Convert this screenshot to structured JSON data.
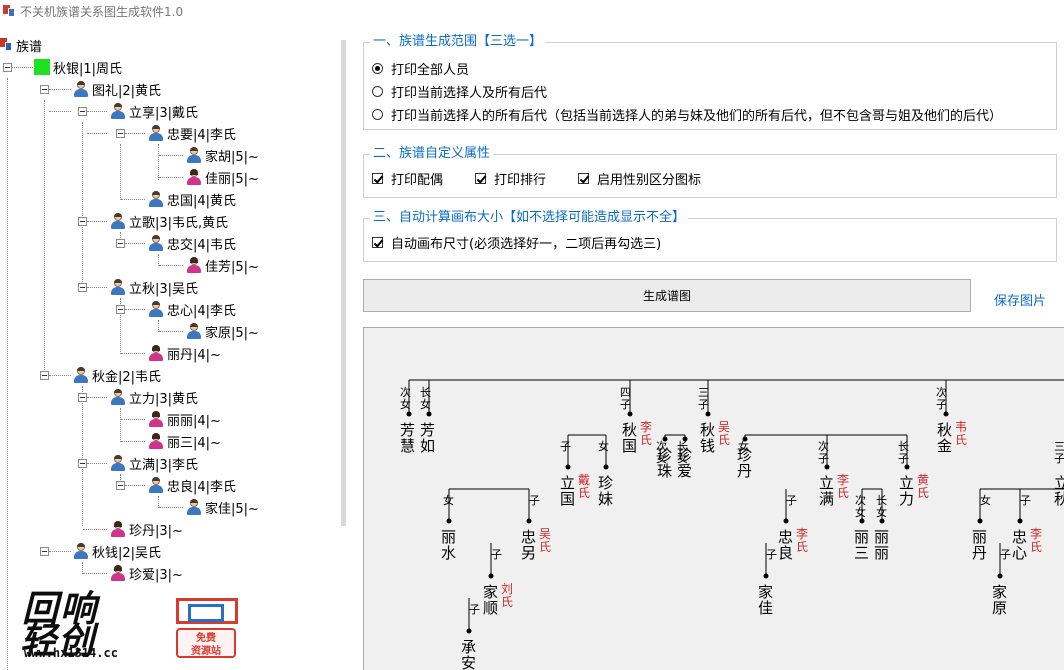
{
  "window": {
    "title": "不关机族谱关系图生成软件1.0"
  },
  "tree": {
    "root_label": "族谱",
    "nodes": [
      {
        "label": "秋银|1|周氏",
        "icon": "green-square-icon"
      },
      {
        "label": "图礼|2|黄氏",
        "icon": "male-person-icon"
      },
      {
        "label": "立享|3|戴氏",
        "icon": "male-person-icon"
      },
      {
        "label": "忠要|4|李氏",
        "icon": "male-person-icon"
      },
      {
        "label": "家胡|5|~",
        "icon": "male-person-icon"
      },
      {
        "label": "佳丽|5|~",
        "icon": "female-person-icon"
      },
      {
        "label": "忠国|4|黄氏",
        "icon": "male-person-icon"
      },
      {
        "label": "立歌|3|韦氏,黄氏",
        "icon": "male-person-icon"
      },
      {
        "label": "忠交|4|韦氏",
        "icon": "male-person-icon"
      },
      {
        "label": "佳芳|5|~",
        "icon": "female-person-icon"
      },
      {
        "label": "立秋|3|吴氏",
        "icon": "male-person-icon"
      },
      {
        "label": "忠心|4|李氏",
        "icon": "male-person-icon"
      },
      {
        "label": "家原|5|~",
        "icon": "male-person-icon"
      },
      {
        "label": "丽丹|4|~",
        "icon": "female-person-icon"
      },
      {
        "label": "秋金|2|韦氏",
        "icon": "male-person-icon"
      },
      {
        "label": "立力|3|黄氏",
        "icon": "male-person-icon"
      },
      {
        "label": "丽丽|4|~",
        "icon": "female-person-icon"
      },
      {
        "label": "丽三|4|~",
        "icon": "female-person-icon"
      },
      {
        "label": "立满|3|李氏",
        "icon": "male-person-icon"
      },
      {
        "label": "忠良|4|李氏",
        "icon": "male-person-icon"
      },
      {
        "label": "家佳|5|~",
        "icon": "male-person-icon"
      },
      {
        "label": "珍丹|3|~",
        "icon": "female-person-icon"
      },
      {
        "label": "秋钱|2|吴氏",
        "icon": "male-person-icon"
      },
      {
        "label": "珍爱|3|~",
        "icon": "female-person-icon"
      }
    ]
  },
  "watermark": {
    "line1": "回响",
    "line2": "轻创",
    "url": "www.hx1314.cc",
    "badge_line1": "免费",
    "badge_line2": "资源站"
  },
  "group1": {
    "legend": "一、族谱生成范围【三选一】",
    "options": [
      {
        "label": "打印全部人员",
        "checked": true
      },
      {
        "label": "打印当前选择人及所有后代",
        "checked": false
      },
      {
        "label": "打印当前选择人的所有后代（包括当前选择人的弟与妹及他们的所有后代，但不包含哥与姐及他们的后代）",
        "checked": false
      }
    ]
  },
  "group2": {
    "legend": "二、族谱自定义属性",
    "options": [
      {
        "label": "打印配偶",
        "checked": true
      },
      {
        "label": "打印排行",
        "checked": true
      },
      {
        "label": "启用性别区分图标",
        "checked": true
      }
    ]
  },
  "group3": {
    "legend": "三、自动计算画布大小【如不选择可能造成显示不全】",
    "option": {
      "label": "自动画布尺寸(必须选择好一，二项后再勾选三)",
      "checked": true
    }
  },
  "actions": {
    "generate_label": "生成谱图",
    "save_label": "保存图片"
  },
  "colors": {
    "accent_blue": "#0b6bc9",
    "spouse_red": "#d0282a",
    "root_green": "#1fe11f"
  },
  "chart_people": [
    {
      "name": "芳慧",
      "rank": "次女",
      "spouse": ""
    },
    {
      "name": "芳如",
      "rank": "长女",
      "spouse": ""
    },
    {
      "name": "秋国",
      "rank": "四子",
      "spouse": "李氏"
    },
    {
      "name": "秋钱",
      "rank": "三子",
      "spouse": "吴氏"
    },
    {
      "name": "秋金",
      "rank": "次子",
      "spouse": "韦氏"
    },
    {
      "name": "立国",
      "rank": "子",
      "spouse": "戴氏"
    },
    {
      "name": "珍妹",
      "rank": "女",
      "spouse": ""
    },
    {
      "name": "珍珠",
      "rank": "次女",
      "spouse": ""
    },
    {
      "name": "珍爱",
      "rank": "长女",
      "spouse": ""
    },
    {
      "name": "珍丹",
      "rank": "女",
      "spouse": ""
    },
    {
      "name": "立满",
      "rank": "次子",
      "spouse": "李氏"
    },
    {
      "name": "立力",
      "rank": "长子",
      "spouse": "黄氏"
    },
    {
      "name": "丽水",
      "rank": "女",
      "spouse": ""
    },
    {
      "name": "忠另",
      "rank": "子",
      "spouse": "吴氏"
    },
    {
      "name": "忠良",
      "rank": "子",
      "spouse": "李氏"
    },
    {
      "name": "丽三",
      "rank": "次女",
      "spouse": ""
    },
    {
      "name": "丽丽",
      "rank": "长女",
      "spouse": ""
    },
    {
      "name": "丽丹",
      "rank": "女",
      "spouse": ""
    },
    {
      "name": "忠心",
      "rank": "子",
      "spouse": "李氏"
    },
    {
      "name": "家顺",
      "rank": "子",
      "spouse": "刘氏"
    },
    {
      "name": "家佳",
      "rank": "子",
      "spouse": ""
    },
    {
      "name": "家原",
      "rank": "子",
      "spouse": ""
    },
    {
      "name": "承安",
      "rank": "子",
      "spouse": ""
    },
    {
      "name": "立秋",
      "rank": "三子",
      "spouse": ""
    }
  ]
}
